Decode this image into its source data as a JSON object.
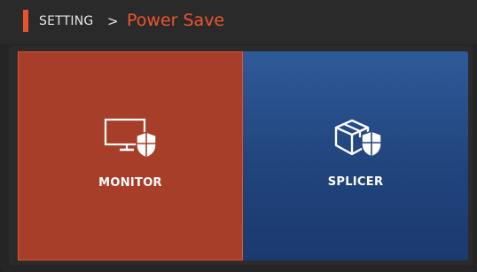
{
  "header": {
    "breadcrumb": "SETTING",
    "separator": ">",
    "title": "Power Save",
    "accent_color": "#e8532e",
    "title_color": "#f0552e"
  },
  "tiles": [
    {
      "label": "MONITOR",
      "icon": "monitor-shield-icon",
      "selected": true,
      "color": "#a73e29"
    },
    {
      "label": "SPLICER",
      "icon": "box-shield-icon",
      "selected": false,
      "color": "#2f5a99"
    }
  ]
}
